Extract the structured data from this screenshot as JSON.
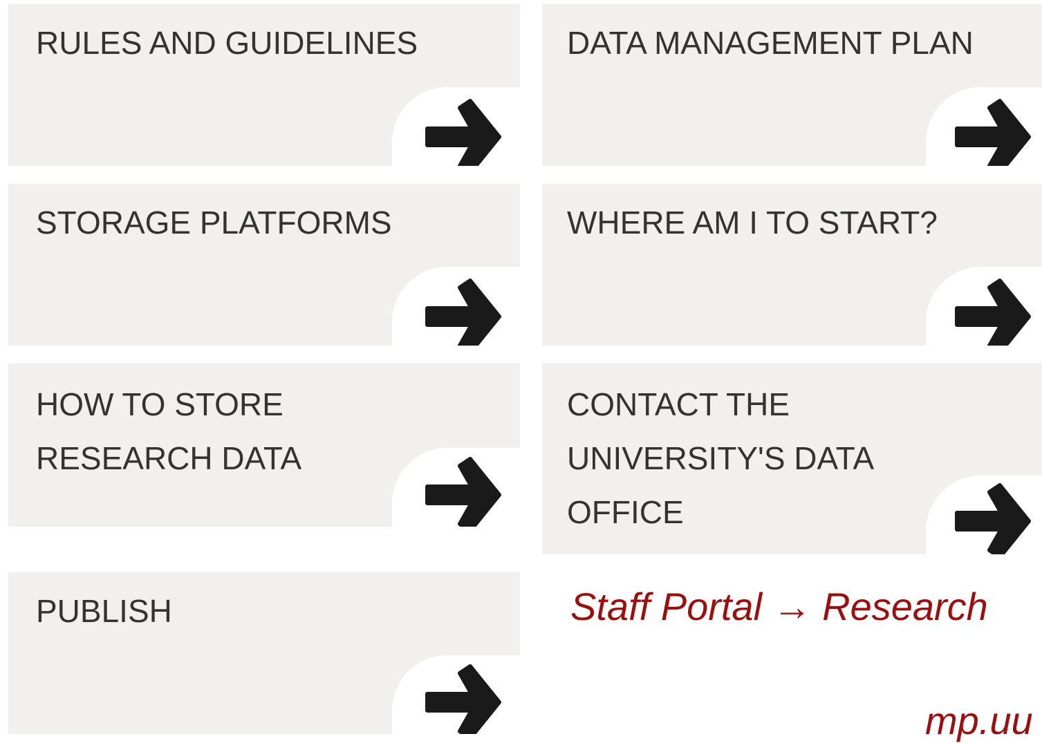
{
  "tiles": {
    "rules": {
      "label": "RULES AND GUIDELINES"
    },
    "dmp": {
      "label": "DATA MANAGEMENT PLAN"
    },
    "storage": {
      "label": "STORAGE PLATFORMS"
    },
    "start": {
      "label": "WHERE AM I TO START?"
    },
    "howto": {
      "label": "HOW TO STORE\nRESEARCH DATA"
    },
    "contact": {
      "label": "CONTACT THE\nUNIVERSITY'S DATA\nOFFICE"
    },
    "publish": {
      "label": "PUBLISH"
    }
  },
  "arrow_icon": "arrow-right-icon",
  "caption": {
    "path": "Staff Portal → Research",
    "url": "mp.uu"
  },
  "colors": {
    "tile_background": "#f1f0ef",
    "tile_text": "#333333",
    "arrow": "#1a1a1a",
    "caption": "#9b0f0f"
  }
}
